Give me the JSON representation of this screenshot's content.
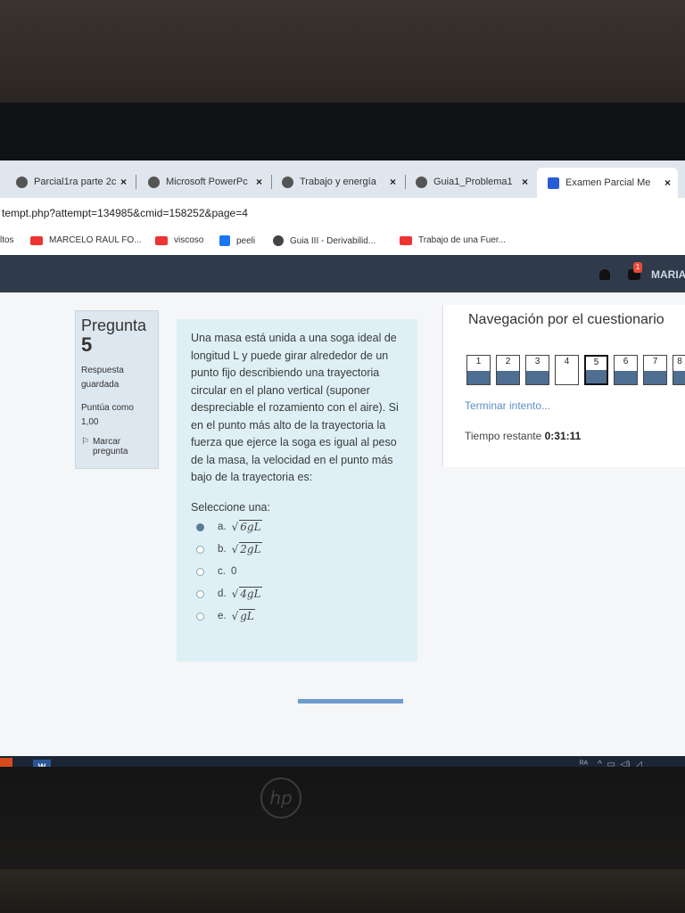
{
  "browser": {
    "tabs": [
      {
        "label": "Parcial1ra parte 2c",
        "icon": "globe-icon"
      },
      {
        "label": "Microsoft PowerPc",
        "icon": "globe-icon"
      },
      {
        "label": "Trabajo y energía",
        "icon": "globe-icon"
      },
      {
        "label": "Guia1_Problema1",
        "icon": "globe-icon"
      },
      {
        "label": "Examen Parcial Me",
        "icon": "ing-icon",
        "active": true
      }
    ],
    "close_glyph": "×",
    "url": "tempt.php?attempt=134985&cmid=158252&page=4",
    "bookmarks": [
      {
        "label": "ltos"
      },
      {
        "label": "MARCELO RAUL FO...",
        "icon": "youtube-icon"
      },
      {
        "label": "viscoso",
        "icon": "youtube-icon"
      },
      {
        "label": "peeli",
        "icon": "facebook-icon"
      },
      {
        "label": "Guia III - Derivabilid...",
        "icon": "globe-icon"
      },
      {
        "label": "Trabajo de una Fuer...",
        "icon": "youtube-icon"
      }
    ]
  },
  "header": {
    "notification_count": "1",
    "user_name": "MARIA"
  },
  "question_info": {
    "label": "Pregunta",
    "number": "5",
    "status": "Respuesta guardada",
    "score": "Puntúa como 1,00",
    "flag_label": "Marcar pregunta"
  },
  "question": {
    "text": "Una masa está unida a una soga ideal de longitud L y puede girar alrededor de un punto fijo describiendo una trayectoria circular en el plano vertical (suponer despreciable el rozamiento con el aire). Si en el punto más alto de la trayectoria la fuerza que ejerce la soga es igual al peso de la masa, la velocidad en el punto más bajo de la trayectoria es:",
    "prompt": "Seleccione una:",
    "options": [
      {
        "letter": "a.",
        "sqrt": "√",
        "value": "6gL",
        "selected": true
      },
      {
        "letter": "b.",
        "sqrt": "√",
        "value": "2gL",
        "selected": false
      },
      {
        "letter": "c.",
        "sqrt": "",
        "value": "0",
        "selected": false
      },
      {
        "letter": "d.",
        "sqrt": "√",
        "value": "4gL",
        "selected": false
      },
      {
        "letter": "e.",
        "sqrt": "√",
        "value": "gL",
        "selected": false
      }
    ]
  },
  "navigation": {
    "title": "Navegación por el cuestionario",
    "buttons": [
      {
        "label": "1",
        "answered": true
      },
      {
        "label": "2",
        "answered": true
      },
      {
        "label": "3",
        "answered": true
      },
      {
        "label": "4",
        "answered": false
      },
      {
        "label": "5",
        "answered": true,
        "current": true
      },
      {
        "label": "6",
        "answered": true
      },
      {
        "label": "7",
        "answered": true
      },
      {
        "label": "8",
        "answered": true
      }
    ],
    "finish_label": "Terminar intento...",
    "timer_label": "Tiempo restante",
    "timer_value": "0:31:11"
  },
  "taskbar": {
    "word_label": "W"
  },
  "device": {
    "logo": "hp"
  },
  "colors": {
    "accent": "#4e6e92",
    "link": "#5b8ec4",
    "navbar": "#2f3a4a",
    "question_bg": "#def0f6"
  }
}
